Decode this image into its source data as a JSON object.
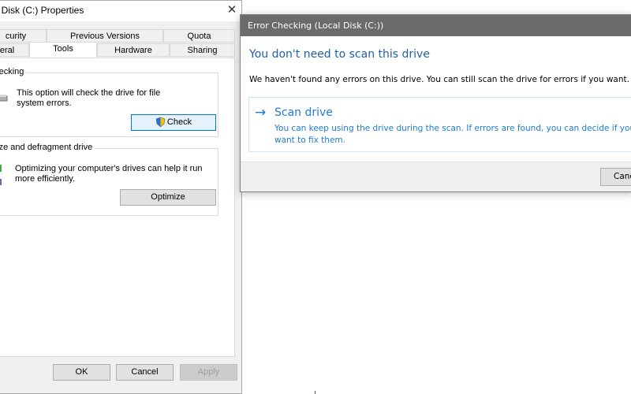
{
  "properties_window": {
    "title": "al Disk (C:) Properties",
    "close_glyph": "✕",
    "tabs_row1": [
      "curity",
      "Previous Versions",
      "Quota"
    ],
    "tabs_row2": [
      "eral",
      "Tools",
      "Hardware",
      "Sharing"
    ],
    "active_tab": "Tools",
    "error_checking": {
      "group_title": "checking",
      "description_line1": "This option will check the drive for file",
      "description_line2": "system errors.",
      "button_label": "Check"
    },
    "optimize": {
      "group_title": "mize and defragment drive",
      "description_line1": "Optimizing your computer's drives can help it run",
      "description_line2": "more efficiently.",
      "button_label": "Optimize"
    },
    "footer": {
      "ok_label": "OK",
      "cancel_label": "Cancel",
      "apply_label": "Apply"
    }
  },
  "error_dialog": {
    "title": "Error Checking (Local Disk (C:))",
    "heading": "You don't need to scan this drive",
    "message": "We haven't found any errors on this drive. You can still scan the drive for errors if you want.",
    "command_link": {
      "arrow": "→",
      "title": "Scan drive",
      "description_line1": "You can keep using the drive during the scan. If errors are found, you can decide if you",
      "description_line2": "want to fix them."
    },
    "cancel_label": "Cance"
  },
  "colors": {
    "dialog_title_bar": "#6b6b6b",
    "heading_blue": "#1e5fad",
    "link_blue": "#1e7bd1",
    "window_bg": "#f0f0f0"
  },
  "icons": {
    "check_button_icon": "uac-shield-icon",
    "error_check_icon": "drive-icon",
    "optimize_icon": "defrag-icon"
  }
}
